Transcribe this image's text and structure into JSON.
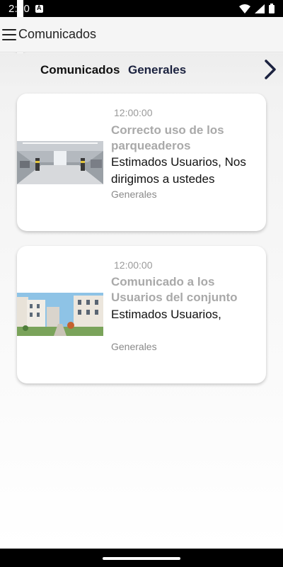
{
  "status_bar": {
    "time": "2:10",
    "icons": [
      "a-notification-icon",
      "sd-card-icon",
      "wifi-icon",
      "signal-icon",
      "battery-icon"
    ]
  },
  "app_bar": {
    "title": "Comunicados",
    "menu_icon": "hamburger-menu-icon"
  },
  "tabs": [
    {
      "label": "Comunicados"
    },
    {
      "label": "Generales"
    }
  ],
  "tab_scroll_icon": "chevron-right-icon",
  "cards": [
    {
      "time": "12:00:00",
      "title": "Correcto uso de los parqueaderos",
      "body": "Estimados Usuarios, Nos dirigimos a ustedes",
      "category": "Generales",
      "image": "parking-garage-photo"
    },
    {
      "time": "12:00:00",
      "title": "Comunicado a los Usuarios del conjunto",
      "body": "Estimados Usuarios,",
      "category": "Generales",
      "image": "apartment-buildings-photo"
    }
  ],
  "colors": {
    "status_bar": "#000000",
    "title_gray": "#a9a9a9",
    "tab_dark": "#1c2340",
    "card_bg": "#ffffff"
  }
}
